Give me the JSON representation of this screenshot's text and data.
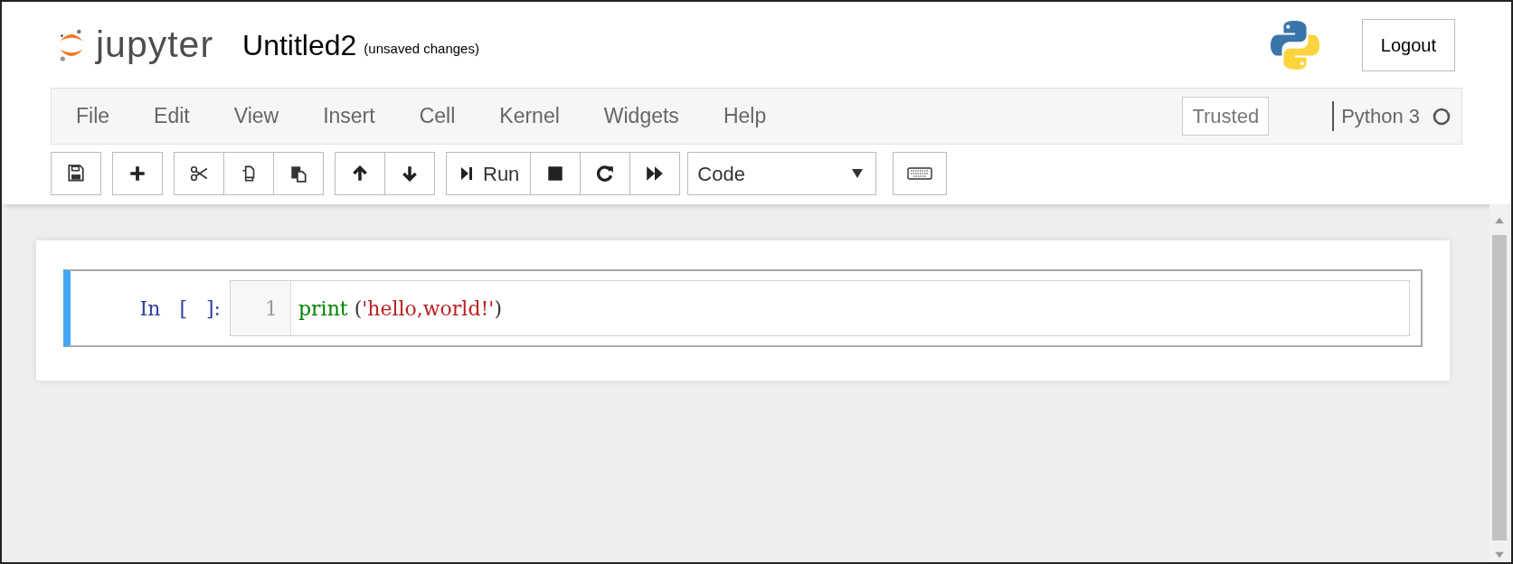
{
  "header": {
    "logo_text": "jupyter",
    "notebook_name": "Untitled2",
    "save_status": "(unsaved changes)",
    "logout": "Logout"
  },
  "menu": [
    "File",
    "Edit",
    "View",
    "Insert",
    "Cell",
    "Kernel",
    "Widgets",
    "Help"
  ],
  "trusted": "Trusted",
  "kernel_name": "Python 3",
  "toolbar": [
    [
      {
        "kind": "save"
      }
    ],
    [
      {
        "kind": "plus"
      }
    ],
    [
      {
        "kind": "cut"
      },
      {
        "kind": "copy"
      },
      {
        "kind": "paste"
      }
    ],
    [
      {
        "kind": "up"
      },
      {
        "kind": "down"
      }
    ],
    [
      {
        "kind": "run",
        "label": "Run"
      },
      {
        "kind": "stop"
      },
      {
        "kind": "restart"
      },
      {
        "kind": "forward"
      }
    ]
  ],
  "cell_type": "Code",
  "cells": [
    {
      "prompt": "In [ ]:",
      "selected": true,
      "lines": [
        {
          "number": "1",
          "tokens": [
            {
              "kind": "builtin",
              "text": "print"
            },
            {
              "kind": "plain",
              "text": " ("
            },
            {
              "kind": "string",
              "text": "'hello,world!'"
            },
            {
              "kind": "plain",
              "text": ")"
            }
          ]
        }
      ]
    }
  ]
}
